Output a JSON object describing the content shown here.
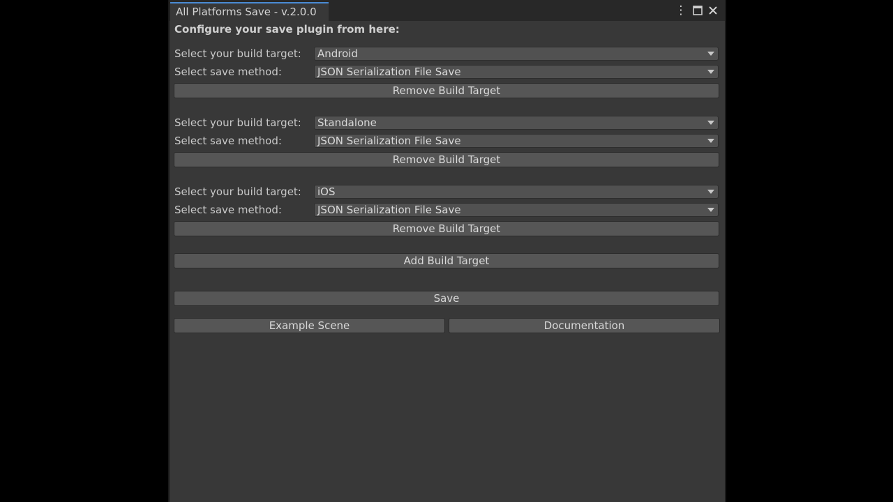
{
  "window": {
    "tab_title": "All Platforms Save - v.2.0.0",
    "icons": {
      "menu": "kebab-menu-icon",
      "maximize": "maximize-icon",
      "close": "close-icon"
    }
  },
  "header": "Configure your save plugin from here:",
  "targets": [
    {
      "target_label": "Select your build target:",
      "target_value": "Android",
      "method_label": "Select save method:",
      "method_value": "JSON Serialization File Save",
      "remove_label": "Remove Build Target"
    },
    {
      "target_label": "Select your build target:",
      "target_value": "Standalone",
      "method_label": "Select save method:",
      "method_value": "JSON Serialization File Save",
      "remove_label": "Remove Build Target"
    },
    {
      "target_label": "Select your build target:",
      "target_value": "iOS",
      "method_label": "Select save method:",
      "method_value": "JSON Serialization File Save",
      "remove_label": "Remove Build Target"
    }
  ],
  "actions": {
    "add_label": "Add Build Target",
    "save_label": "Save",
    "example_label": "Example Scene",
    "docs_label": "Documentation"
  },
  "colors": {
    "background": "#383838",
    "button": "#565656",
    "dropdown": "#515151",
    "accent": "#4a8bd4"
  }
}
